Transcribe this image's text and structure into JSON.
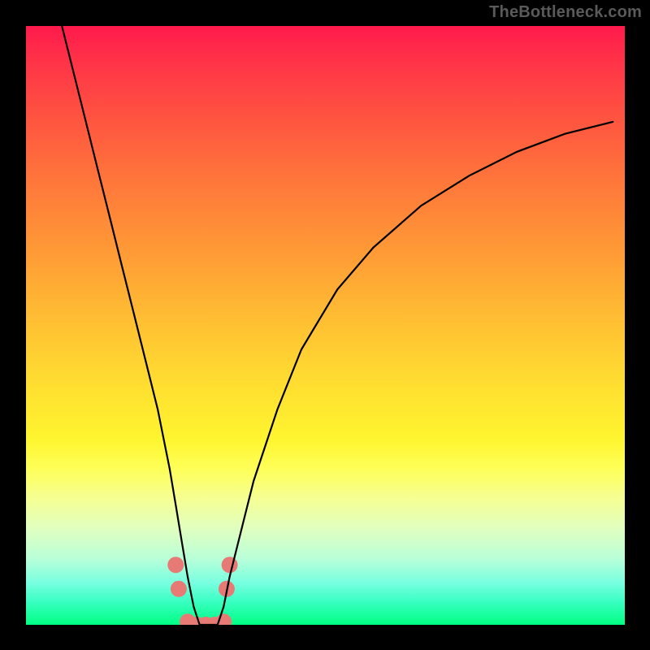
{
  "watermark": {
    "text": "TheBottleneck.com"
  },
  "chart_data": {
    "type": "line",
    "title": "",
    "xlabel": "",
    "ylabel": "",
    "xlim": [
      0,
      100
    ],
    "ylim": [
      0,
      100
    ],
    "grid": false,
    "legend": false,
    "background": {
      "type": "vertical-gradient",
      "stops": [
        {
          "pos": 0,
          "color": "#ff1a4c"
        },
        {
          "pos": 50,
          "color": "#ffd400"
        },
        {
          "pos": 80,
          "color": "#f5ff60"
        },
        {
          "pos": 100,
          "color": "#00ff84"
        }
      ],
      "meaning": "red=high bottleneck, green=low bottleneck"
    },
    "series": [
      {
        "name": "bottleneck-curve",
        "color": "#000000",
        "x": [
          6,
          8,
          10,
          12,
          14,
          16,
          18,
          20,
          22,
          24,
          25,
          26,
          27,
          28,
          29,
          30,
          31,
          32,
          33,
          34,
          36,
          38,
          42,
          46,
          52,
          58,
          66,
          74,
          82,
          90,
          98
        ],
        "y": [
          100,
          92,
          84,
          76,
          68,
          60,
          52,
          44,
          36,
          26,
          20,
          14,
          8,
          3,
          0,
          0,
          0,
          0,
          3,
          8,
          16,
          24,
          36,
          46,
          56,
          63,
          70,
          75,
          79,
          82,
          84
        ]
      }
    ],
    "markers": [
      {
        "name": "dot-left-upper",
        "x": 25.0,
        "y": 10,
        "color": "#e77a74",
        "r": 10
      },
      {
        "name": "dot-left-lower",
        "x": 25.5,
        "y": 6,
        "color": "#e77a74",
        "r": 10
      },
      {
        "name": "dot-right-upper",
        "x": 34.0,
        "y": 10,
        "color": "#e77a74",
        "r": 10
      },
      {
        "name": "dot-right-lower",
        "x": 33.5,
        "y": 6,
        "color": "#e77a74",
        "r": 10
      },
      {
        "name": "trough-dot-1",
        "x": 27.0,
        "y": 0.5,
        "color": "#e77a74",
        "r": 10
      },
      {
        "name": "trough-dot-2",
        "x": 28.5,
        "y": 0,
        "color": "#e77a74",
        "r": 10
      },
      {
        "name": "trough-dot-3",
        "x": 30.0,
        "y": 0,
        "color": "#e77a74",
        "r": 10
      },
      {
        "name": "trough-dot-4",
        "x": 31.5,
        "y": 0,
        "color": "#e77a74",
        "r": 10
      },
      {
        "name": "trough-dot-5",
        "x": 33.0,
        "y": 0.5,
        "color": "#e77a74",
        "r": 10
      }
    ]
  }
}
